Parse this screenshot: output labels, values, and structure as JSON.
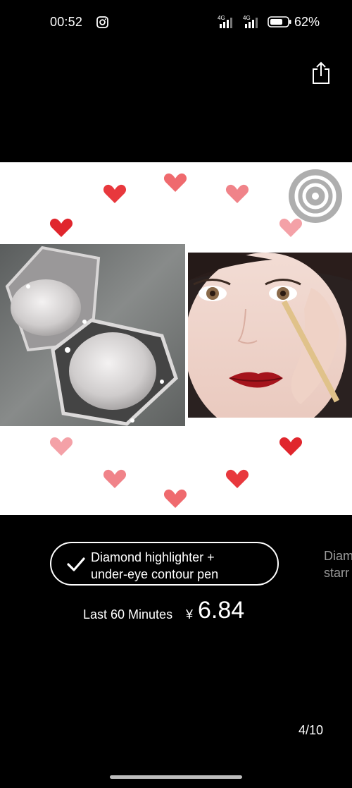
{
  "status_bar": {
    "time": "00:52",
    "battery_percent": "62%",
    "signal_1_label": "4G",
    "signal_2_label": "4G",
    "icons": [
      "instagram-icon",
      "signal-4g-icon",
      "signal-4g-icon",
      "battery-icon"
    ]
  },
  "toolbar": {
    "share_icon": "share-icon"
  },
  "gallery": {
    "current_page": "4/10",
    "scan_icon": "concentric-circles-icon"
  },
  "options": {
    "selected": {
      "label": "Diamond highlighter +\nunder-eye contour pen",
      "icon": "checkmark-icon"
    },
    "next": {
      "label": "Diam\nstarr"
    }
  },
  "price": {
    "label": "Last 60 Minutes",
    "currency": "¥",
    "value": "6.84"
  },
  "colors": {
    "background": "#000000",
    "image_background": "#ffffff",
    "heart_red": "#e8383d",
    "heart_pink": "#f4a1a7"
  }
}
